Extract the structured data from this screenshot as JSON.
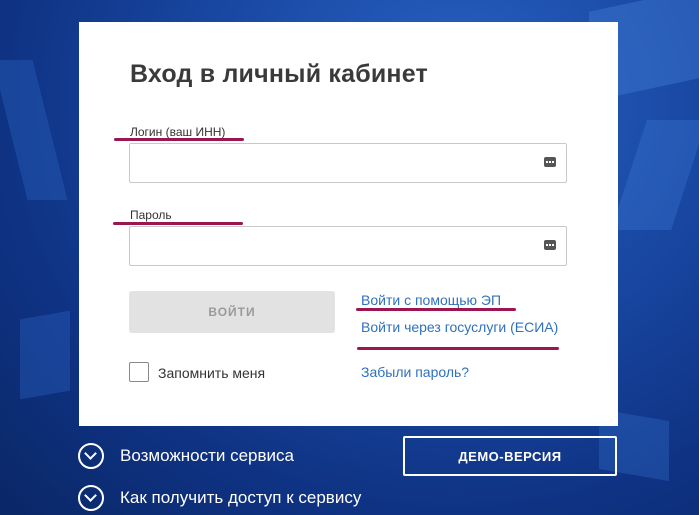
{
  "colors": {
    "background": "#1a4aa6",
    "card": "#ffffff",
    "link": "#2f71bd",
    "annotation": "#9b1550",
    "button_disabled": "#e2e2e2"
  },
  "login_form": {
    "title": "Вход в личный кабинет",
    "login_label": "Логин (ваш ИНН)",
    "login_value": "",
    "password_label": "Пароль",
    "password_value": "",
    "field_icon": "keyboard-icon",
    "submit_label": "ВОЙТИ",
    "ep_link": "Войти с помощью ЭП",
    "esia_link": "Войти через госуслуги (ЕСИА)",
    "remember_label": "Запомнить меня",
    "forgot_link": "Забыли пароль?"
  },
  "bottom": {
    "features_label": "Возможности сервиса",
    "access_label": "Как получить доступ к сервису",
    "demo_button": "ДЕМО-ВЕРСИЯ",
    "expand_icon": "chevron-down-circle-icon"
  }
}
